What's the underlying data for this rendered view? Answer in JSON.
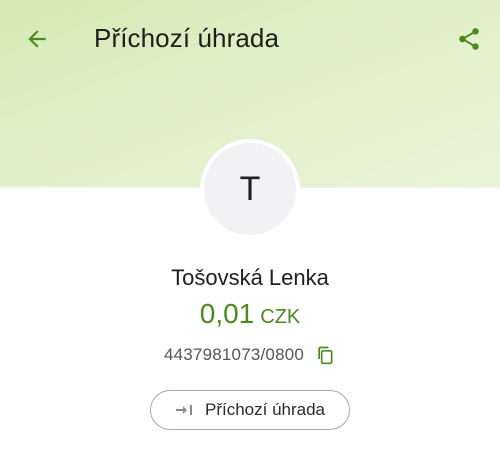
{
  "colors": {
    "accent_green": "#4b8a1f",
    "header_bg": "#e1f0c8"
  },
  "header": {
    "title": "Příchozí úhrada",
    "back_icon": "arrow-left-icon",
    "share_icon": "share-icon"
  },
  "counterparty": {
    "avatar_initial": "T",
    "name": "Tošovská Lenka"
  },
  "amount": {
    "value": "0,01",
    "currency": "CZK"
  },
  "account": {
    "number": "4437981073/0800",
    "copy_icon": "copy-icon"
  },
  "transaction_type": {
    "label": "Příchozí úhrada",
    "icon": "incoming-arrow-icon"
  }
}
